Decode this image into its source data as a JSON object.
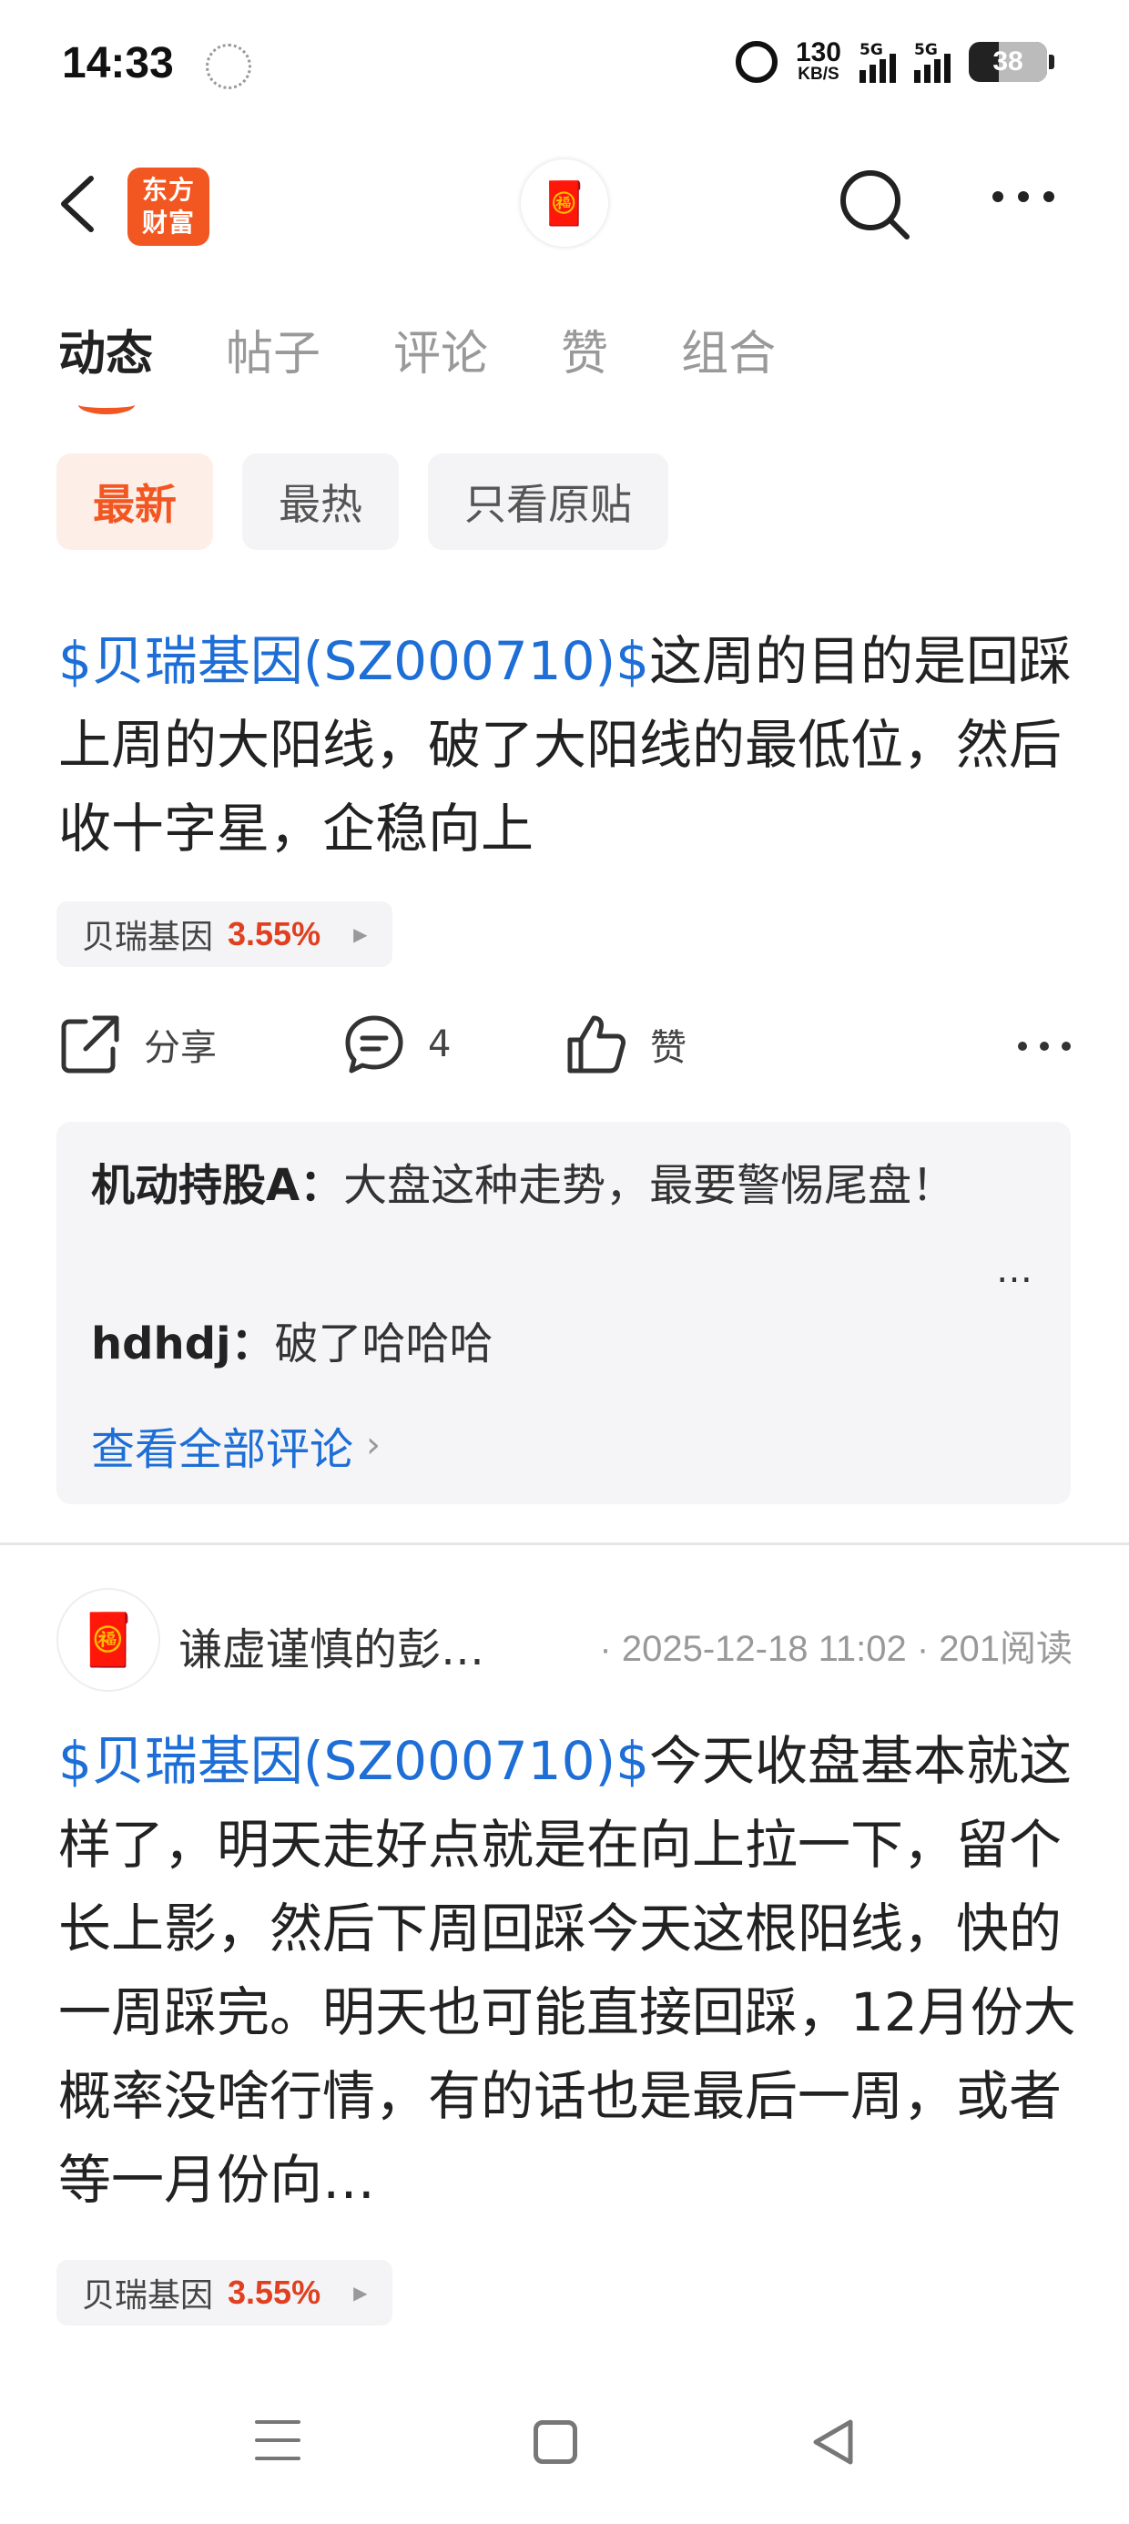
{
  "status_bar": {
    "time": "14:33",
    "net_speed_value": "130",
    "net_speed_unit": "KB/S",
    "signal1": "5G",
    "signal2": "5G",
    "battery": "38"
  },
  "header": {
    "logo_text_line1": "东方",
    "logo_text_line2": "财富"
  },
  "tabs": [
    {
      "label": "动态",
      "active": true
    },
    {
      "label": "帖子"
    },
    {
      "label": "评论"
    },
    {
      "label": "赞"
    },
    {
      "label": "组合"
    }
  ],
  "filters": [
    {
      "label": "最新",
      "active": true
    },
    {
      "label": "最热"
    },
    {
      "label": "只看原贴"
    }
  ],
  "posts": [
    {
      "stock_link": "$贝瑞基因(SZ000710)$",
      "body": "这周的目的是回踩上周的大阳线，破了大阳线的最低位，然后收十字星，企稳向上",
      "tag_name": "贝瑞基因",
      "tag_pct": "3.55%",
      "share_label": "分享",
      "comment_count": "4",
      "like_label": "赞",
      "comments": [
        {
          "author": "机动持股A：",
          "text": "大盘这种走势，最要警惕尾盘！"
        },
        {
          "author": "hdhdj：",
          "text": "破了哈哈哈"
        }
      ],
      "view_all": "查看全部评论"
    },
    {
      "author": "谦虚谨慎的彭…",
      "meta": "· 2025-12-18 11:02 · 201阅读",
      "stock_link": "$贝瑞基因(SZ000710)$",
      "body": "今天收盘基本就这样了，明天走好点就是在向上拉一下，留个长上影，然后下周回踩今天这根阳线，快的一周踩完。明天也可能直接回踩，12月份大概率没啥行情，有的话也是最后一周，或者等一月份向…",
      "tag_name": "贝瑞基因",
      "tag_pct": "3.55%"
    }
  ]
}
